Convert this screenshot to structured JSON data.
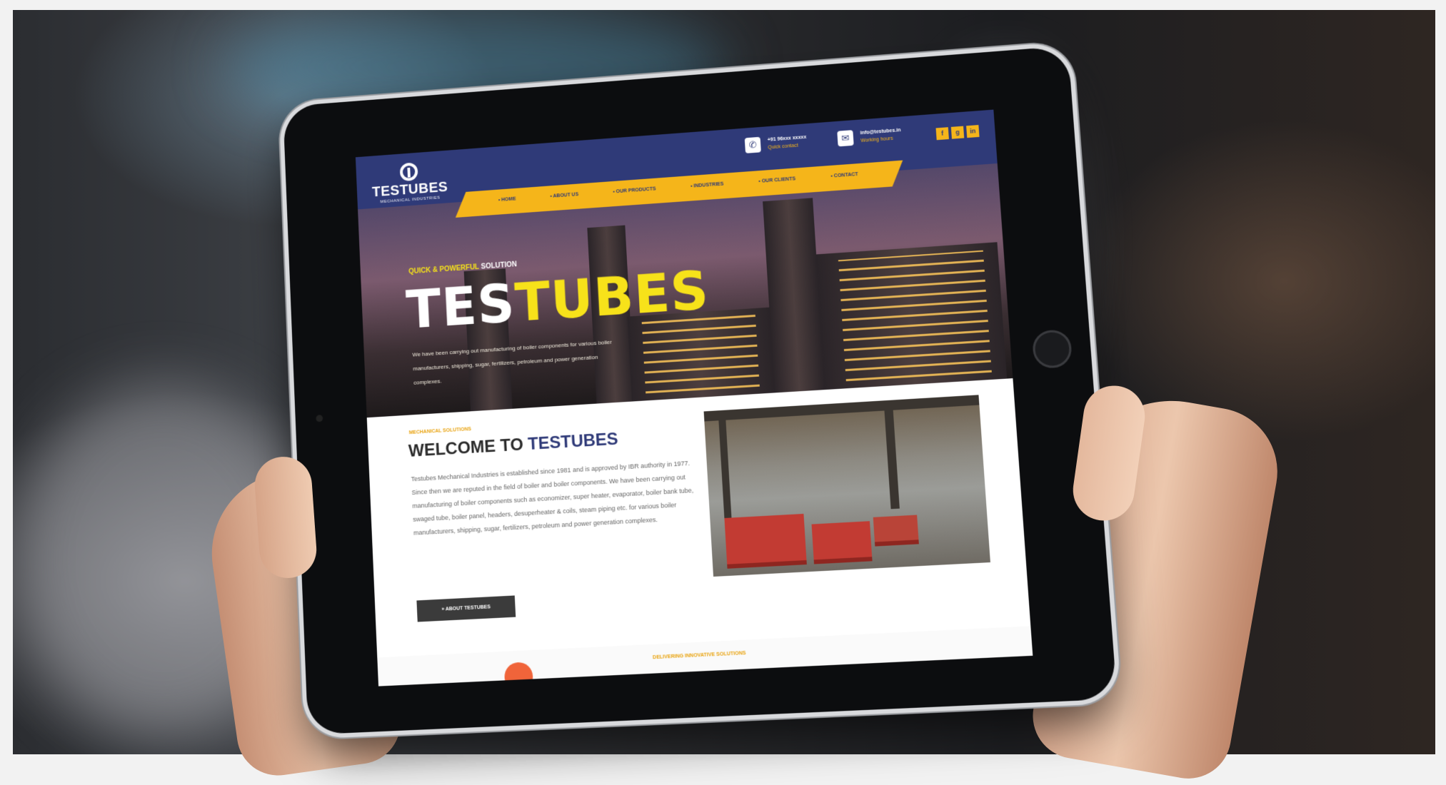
{
  "site": {
    "logo_name": "TESTUBES",
    "logo_sub": "MECHANICAL INDUSTRIES",
    "phone": "+91 96xxx xxxxx",
    "phone_sub": "Quick contact",
    "email": "info@testubes.in",
    "email_sub": "Working hours",
    "socials": [
      "f",
      "g",
      "in"
    ],
    "nav": [
      "HOME",
      "ABOUT US",
      "OUR PRODUCTS",
      "INDUSTRIES",
      "OUR CLIENTS",
      "CONTACT"
    ]
  },
  "hero": {
    "tag_lead": "QUICK & POWERFUL",
    "tag_rest": "SOLUTION",
    "title_a": "TES",
    "title_b": "TUBES",
    "text": "We have been carrying out manufacturing of boiler components for various boiler manufacturers, shipping, sugar, fertilizers, petroleum and power generation complexes."
  },
  "welcome": {
    "tag": "MECHANICAL SOLUTIONS",
    "title_a": "WELCOME TO",
    "title_b": "TESTUBES",
    "body": "Testubes Mechanical Industries is established since 1981 and is approved by IBR authority in 1977. Since then we are reputed in the field of boiler and boiler components. We have been carrying out manufacturing of boiler components such as economizer, super heater, evaporator, boiler bank tube, swaged tube, boiler panel, headers, desuperheater & coils, steam piping etc. for various boiler manufacturers, shipping, sugar, fertilizers, petroleum and power generation complexes.",
    "button": "» ABOUT TESTUBES",
    "footer_tag": "DELIVERING INNOVATIVE SOLUTIONS"
  },
  "colors": {
    "brand_navy": "#2f3a78",
    "brand_yellow": "#f5b51a",
    "title_yellow": "#f7e21a"
  }
}
